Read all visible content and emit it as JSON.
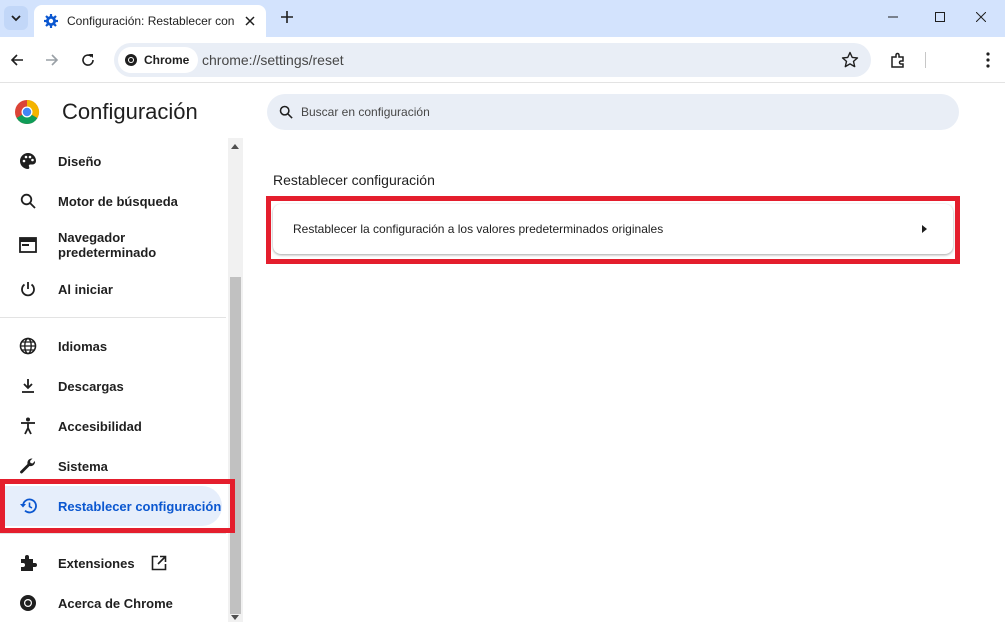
{
  "browser": {
    "tab_title": "Configuración: Restablecer con",
    "chip_label": "Chrome",
    "url": "chrome://settings/reset"
  },
  "sidebar": {
    "brand": "Configuración",
    "items": [
      {
        "label": "Diseño",
        "icon": "palette-icon"
      },
      {
        "label": "Motor de búsqueda",
        "icon": "search-icon"
      },
      {
        "label": "Navegador predeterminado",
        "icon": "browser-window-icon"
      },
      {
        "label": "Al iniciar",
        "icon": "power-icon"
      },
      {
        "label": "Idiomas",
        "icon": "globe-icon"
      },
      {
        "label": "Descargas",
        "icon": "download-icon"
      },
      {
        "label": "Accesibilidad",
        "icon": "accessibility-icon"
      },
      {
        "label": "Sistema",
        "icon": "wrench-icon"
      },
      {
        "label": "Restablecer configuración",
        "icon": "history-reset-icon"
      },
      {
        "label": "Extensiones",
        "icon": "puzzle-icon"
      },
      {
        "label": "Acerca de Chrome",
        "icon": "chrome-icon"
      }
    ],
    "active_index": 8
  },
  "main": {
    "search_placeholder": "Buscar en configuración",
    "section_title": "Restablecer configuración",
    "reset_row_label": "Restablecer la configuración a los valores predeterminados originales"
  },
  "colors": {
    "accent": "#0b57d0",
    "highlight": "#e41e2d",
    "tabstrip": "#d3e3fd",
    "omnibox": "#e9eef6"
  }
}
